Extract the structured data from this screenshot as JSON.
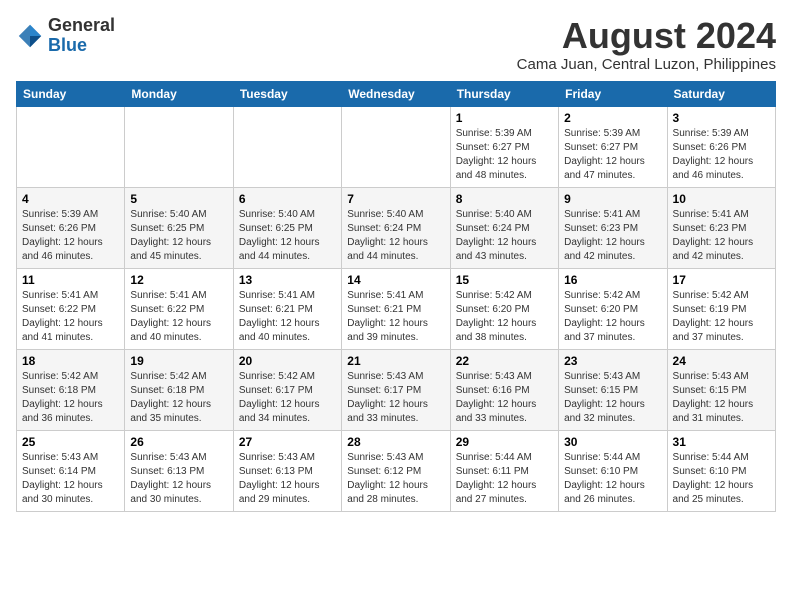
{
  "header": {
    "logo_general": "General",
    "logo_blue": "Blue",
    "month_year": "August 2024",
    "location": "Cama Juan, Central Luzon, Philippines"
  },
  "days_of_week": [
    "Sunday",
    "Monday",
    "Tuesday",
    "Wednesday",
    "Thursday",
    "Friday",
    "Saturday"
  ],
  "weeks": [
    [
      {
        "day": "",
        "info": ""
      },
      {
        "day": "",
        "info": ""
      },
      {
        "day": "",
        "info": ""
      },
      {
        "day": "",
        "info": ""
      },
      {
        "day": "1",
        "info": "Sunrise: 5:39 AM\nSunset: 6:27 PM\nDaylight: 12 hours\nand 48 minutes."
      },
      {
        "day": "2",
        "info": "Sunrise: 5:39 AM\nSunset: 6:27 PM\nDaylight: 12 hours\nand 47 minutes."
      },
      {
        "day": "3",
        "info": "Sunrise: 5:39 AM\nSunset: 6:26 PM\nDaylight: 12 hours\nand 46 minutes."
      }
    ],
    [
      {
        "day": "4",
        "info": "Sunrise: 5:39 AM\nSunset: 6:26 PM\nDaylight: 12 hours\nand 46 minutes."
      },
      {
        "day": "5",
        "info": "Sunrise: 5:40 AM\nSunset: 6:25 PM\nDaylight: 12 hours\nand 45 minutes."
      },
      {
        "day": "6",
        "info": "Sunrise: 5:40 AM\nSunset: 6:25 PM\nDaylight: 12 hours\nand 44 minutes."
      },
      {
        "day": "7",
        "info": "Sunrise: 5:40 AM\nSunset: 6:24 PM\nDaylight: 12 hours\nand 44 minutes."
      },
      {
        "day": "8",
        "info": "Sunrise: 5:40 AM\nSunset: 6:24 PM\nDaylight: 12 hours\nand 43 minutes."
      },
      {
        "day": "9",
        "info": "Sunrise: 5:41 AM\nSunset: 6:23 PM\nDaylight: 12 hours\nand 42 minutes."
      },
      {
        "day": "10",
        "info": "Sunrise: 5:41 AM\nSunset: 6:23 PM\nDaylight: 12 hours\nand 42 minutes."
      }
    ],
    [
      {
        "day": "11",
        "info": "Sunrise: 5:41 AM\nSunset: 6:22 PM\nDaylight: 12 hours\nand 41 minutes."
      },
      {
        "day": "12",
        "info": "Sunrise: 5:41 AM\nSunset: 6:22 PM\nDaylight: 12 hours\nand 40 minutes."
      },
      {
        "day": "13",
        "info": "Sunrise: 5:41 AM\nSunset: 6:21 PM\nDaylight: 12 hours\nand 40 minutes."
      },
      {
        "day": "14",
        "info": "Sunrise: 5:41 AM\nSunset: 6:21 PM\nDaylight: 12 hours\nand 39 minutes."
      },
      {
        "day": "15",
        "info": "Sunrise: 5:42 AM\nSunset: 6:20 PM\nDaylight: 12 hours\nand 38 minutes."
      },
      {
        "day": "16",
        "info": "Sunrise: 5:42 AM\nSunset: 6:20 PM\nDaylight: 12 hours\nand 37 minutes."
      },
      {
        "day": "17",
        "info": "Sunrise: 5:42 AM\nSunset: 6:19 PM\nDaylight: 12 hours\nand 37 minutes."
      }
    ],
    [
      {
        "day": "18",
        "info": "Sunrise: 5:42 AM\nSunset: 6:18 PM\nDaylight: 12 hours\nand 36 minutes."
      },
      {
        "day": "19",
        "info": "Sunrise: 5:42 AM\nSunset: 6:18 PM\nDaylight: 12 hours\nand 35 minutes."
      },
      {
        "day": "20",
        "info": "Sunrise: 5:42 AM\nSunset: 6:17 PM\nDaylight: 12 hours\nand 34 minutes."
      },
      {
        "day": "21",
        "info": "Sunrise: 5:43 AM\nSunset: 6:17 PM\nDaylight: 12 hours\nand 33 minutes."
      },
      {
        "day": "22",
        "info": "Sunrise: 5:43 AM\nSunset: 6:16 PM\nDaylight: 12 hours\nand 33 minutes."
      },
      {
        "day": "23",
        "info": "Sunrise: 5:43 AM\nSunset: 6:15 PM\nDaylight: 12 hours\nand 32 minutes."
      },
      {
        "day": "24",
        "info": "Sunrise: 5:43 AM\nSunset: 6:15 PM\nDaylight: 12 hours\nand 31 minutes."
      }
    ],
    [
      {
        "day": "25",
        "info": "Sunrise: 5:43 AM\nSunset: 6:14 PM\nDaylight: 12 hours\nand 30 minutes."
      },
      {
        "day": "26",
        "info": "Sunrise: 5:43 AM\nSunset: 6:13 PM\nDaylight: 12 hours\nand 30 minutes."
      },
      {
        "day": "27",
        "info": "Sunrise: 5:43 AM\nSunset: 6:13 PM\nDaylight: 12 hours\nand 29 minutes."
      },
      {
        "day": "28",
        "info": "Sunrise: 5:43 AM\nSunset: 6:12 PM\nDaylight: 12 hours\nand 28 minutes."
      },
      {
        "day": "29",
        "info": "Sunrise: 5:44 AM\nSunset: 6:11 PM\nDaylight: 12 hours\nand 27 minutes."
      },
      {
        "day": "30",
        "info": "Sunrise: 5:44 AM\nSunset: 6:10 PM\nDaylight: 12 hours\nand 26 minutes."
      },
      {
        "day": "31",
        "info": "Sunrise: 5:44 AM\nSunset: 6:10 PM\nDaylight: 12 hours\nand 25 minutes."
      }
    ]
  ]
}
